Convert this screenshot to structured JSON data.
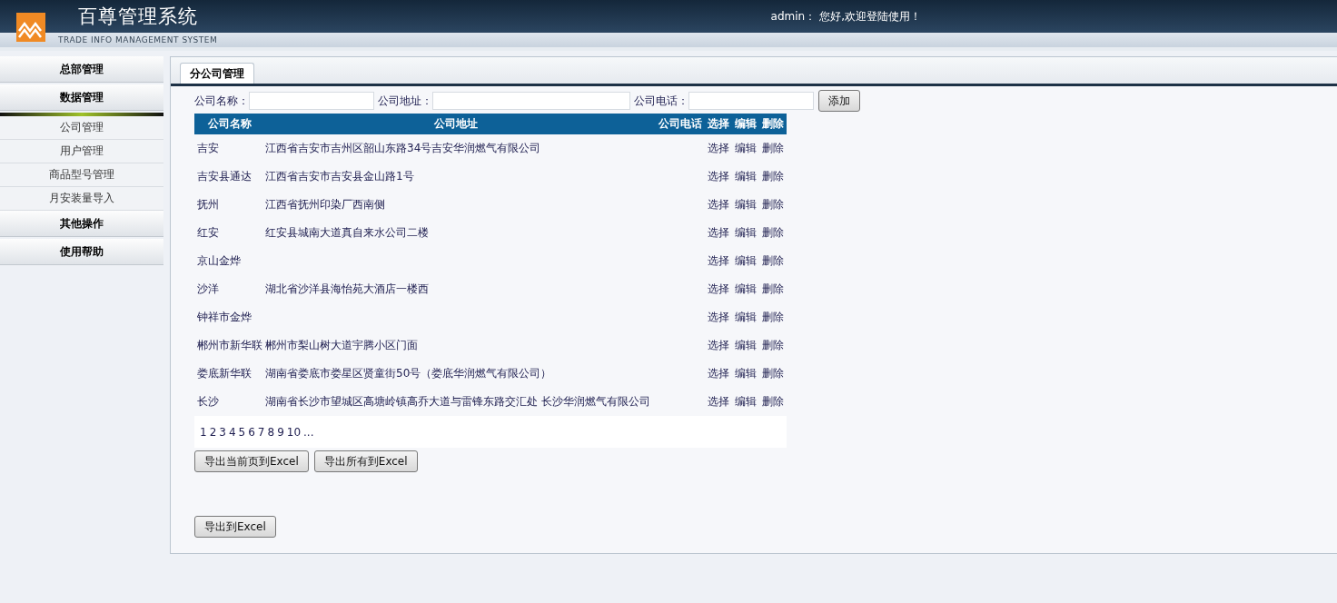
{
  "header": {
    "title": "百尊管理系统",
    "subtitle": "TRADE INFO MANAGEMENT SYSTEM",
    "user": "admin：",
    "greeting": "您好,欢迎登陆使用！"
  },
  "sidebar": {
    "groups": [
      {
        "label": "总部管理"
      },
      {
        "label": "数据管理",
        "items": [
          "公司管理",
          "用户管理",
          "商品型号管理",
          "月安装量导入"
        ]
      },
      {
        "label": "其他操作"
      },
      {
        "label": "使用帮助"
      }
    ]
  },
  "tabs": [
    {
      "label": "分公司管理",
      "selected": true
    }
  ],
  "form": {
    "fields": [
      {
        "label": "公司名称：",
        "wide": false
      },
      {
        "label": "公司地址：",
        "wide": true
      },
      {
        "label": "公司电话：",
        "wide": false
      }
    ],
    "add_button": "添加"
  },
  "table": {
    "columns": [
      "公司名称",
      "公司地址",
      "公司电话",
      "选择",
      "编辑",
      "删除"
    ],
    "rows": [
      {
        "name": "吉安",
        "address": "江西省吉安市吉州区韶山东路34号吉安华润燃气有限公司",
        "actions": [
          "选择",
          "编辑",
          "删除"
        ]
      },
      {
        "name": "吉安县通达",
        "address": "江西省吉安市吉安县金山路1号",
        "actions": [
          "选择",
          "编辑",
          "删除"
        ]
      },
      {
        "name": "抚州",
        "address": "江西省抚州印染厂西南侧",
        "actions": [
          "选择",
          "编辑",
          "删除"
        ]
      },
      {
        "name": "红安",
        "address": "红安县城南大道真自来水公司二楼",
        "actions": [
          "选择",
          "编辑",
          "删除"
        ]
      },
      {
        "name": "京山金烨",
        "actions": [
          "选择",
          "编辑",
          "删除"
        ]
      },
      {
        "name": "沙洋",
        "address": "湖北省沙洋县海怡苑大酒店一楼西",
        "actions": [
          "选择",
          "编辑",
          "删除"
        ]
      },
      {
        "name": "钟祥市金烨",
        "actions": [
          "选择",
          "编辑",
          "删除"
        ]
      },
      {
        "name": "郴州市新华联",
        "address": "郴州市梨山树大道宇腾小区门面",
        "actions": [
          "选择",
          "编辑",
          "删除"
        ]
      },
      {
        "name": "娄底新华联",
        "address": "湖南省娄底市娄星区贤童街50号（娄底华润燃气有限公司）",
        "actions": [
          "选择",
          "编辑",
          "删除"
        ]
      },
      {
        "name": "长沙",
        "address": "湖南省长沙市望城区高塘岭镇高乔大道与雷锋东路交汇处 长沙华润燃气有限公司",
        "actions": [
          "选择",
          "编辑",
          "删除"
        ]
      }
    ],
    "pagination": [
      "1",
      "2",
      "3",
      "4",
      "5",
      "6",
      "7",
      "8",
      "9",
      "10",
      "..."
    ]
  },
  "export_buttons": [
    "导出当前页到Excel",
    "导出所有到Excel"
  ],
  "export_all_button": "导出到Excel"
}
